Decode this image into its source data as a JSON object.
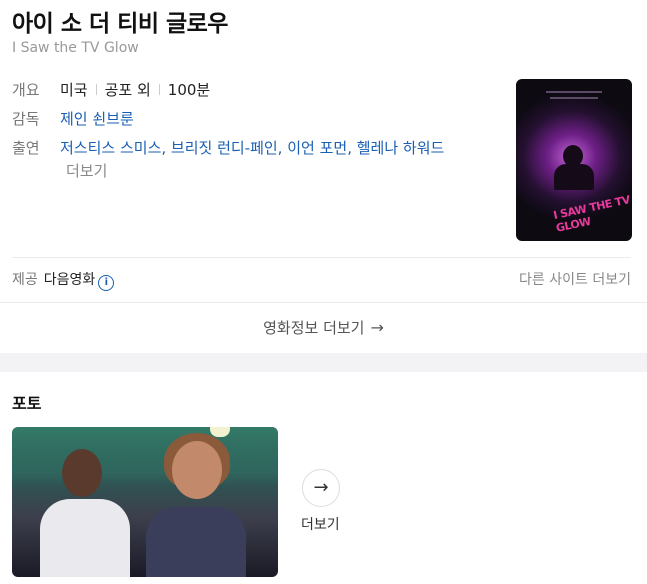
{
  "movie": {
    "title": "아이 소 더 티비 글로우",
    "original_title": "I Saw the TV Glow"
  },
  "info": {
    "overview_label": "개요",
    "country": "미국",
    "genre": "공포 외",
    "runtime": "100분",
    "director_label": "감독",
    "director": "제인 쇤브룬",
    "cast_label": "출연",
    "cast": "저스티스 스미스, 브리짓 런디-페인, 이언 포먼, 헬레나 하워드",
    "cast_more": "더보기"
  },
  "provider": {
    "label": "제공",
    "name": "다음영화",
    "info_icon": "i",
    "other_sites": "다른 사이트 더보기"
  },
  "movie_more": {
    "label": "영화정보 더보기",
    "arrow": "→"
  },
  "photos": {
    "section_title": "포토",
    "more_arrow": "→",
    "more_label": "더보기"
  },
  "poster": {
    "text": "I SAW THE TV GLOW"
  }
}
